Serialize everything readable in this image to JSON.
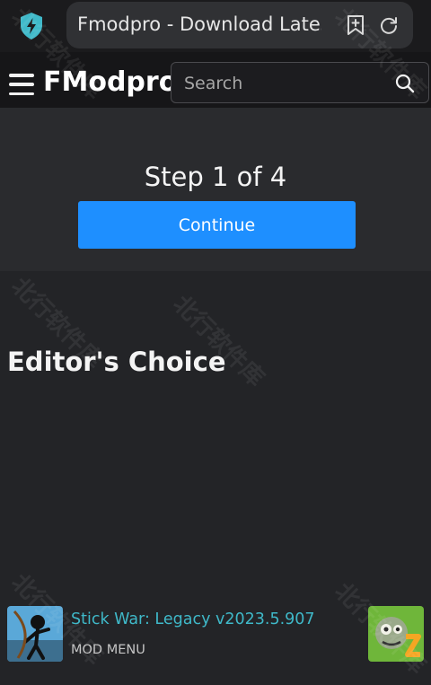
{
  "browser": {
    "url_title": "Fmodpro - Download Latest",
    "icons": [
      "shield-bolt-icon",
      "bookmark-add-icon",
      "reload-icon"
    ]
  },
  "header": {
    "brand": "FModpro",
    "search_placeholder": "Search",
    "icons": [
      "hamburger-menu-icon",
      "search-icon"
    ]
  },
  "step": {
    "text": "Step 1 of 4",
    "continue_label": "Continue"
  },
  "editors_choice": {
    "title": "Editor's Choice"
  },
  "app_item": {
    "title": "Stick War: Legacy v2023.5.907",
    "subtitle": "MOD MENU"
  },
  "watermark": "北行软件库",
  "colors": {
    "accent": "#1e8fff",
    "link": "#3fb9c9",
    "background": "#232427",
    "header": "#161618"
  }
}
